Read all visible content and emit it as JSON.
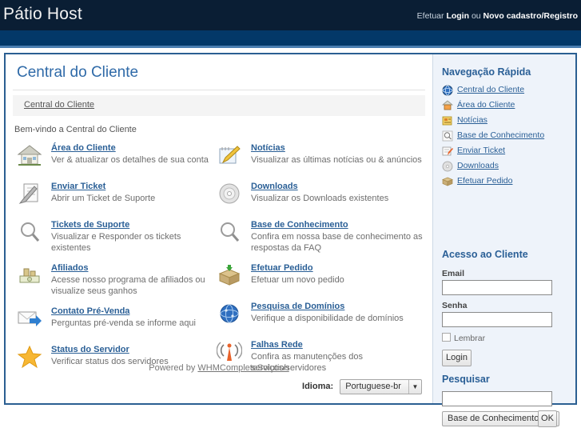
{
  "header": {
    "brand": "Pátio Host",
    "auth_prefix": "Efetuar",
    "login_label": "Login",
    "auth_sep": "ou",
    "register_label": "Novo cadastro/Registro"
  },
  "main": {
    "page_title": "Central do Cliente",
    "breadcrumb": "Central do Cliente",
    "welcome": "Bem-vindo a Central do Cliente",
    "powered_prefix": "Powered by",
    "powered_link": "WHMCompleteSolution",
    "language_label": "Idioma:",
    "language_value": "Portuguese-br",
    "left_items": [
      {
        "icon": "house-icon",
        "title": "Área do Cliente",
        "desc": "Ver & atualizar os detalhes de sua conta"
      },
      {
        "icon": "pencil-paper-icon",
        "title": "Enviar Ticket",
        "desc": "Abrir um Ticket de Suporte"
      },
      {
        "icon": "magnifier-icon",
        "title": "Tickets de Suporte",
        "desc": "Visualizar e Responder os tickets existentes"
      },
      {
        "icon": "money-icon",
        "title": "Afiliados",
        "desc": "Acesse nosso programa de afiliados ou visualize seus ganhos"
      },
      {
        "icon": "envelope-arrow-icon",
        "title": "Contato Pré-Venda",
        "desc": "Perguntas pré-venda se informe aqui"
      },
      {
        "icon": "star-icon",
        "title": "Status do Servidor",
        "desc": "Verificar status dos servidores"
      }
    ],
    "right_items": [
      {
        "icon": "notepad-pencil-icon",
        "title": "Notícias",
        "desc": "Visualizar as últimas notícias ou & anúncios"
      },
      {
        "icon": "disc-icon",
        "title": "Downloads",
        "desc": "Visualizar os Downloads existentes"
      },
      {
        "icon": "magnifier-icon",
        "title": "Base de Conhecimento",
        "desc": "Confira em nossa base de conhecimento as respostas da FAQ"
      },
      {
        "icon": "box-icon",
        "title": "Efetuar Pedido",
        "desc": "Efetuar um novo pedido"
      },
      {
        "icon": "globe-icon",
        "title": "Pesquisa de Domínios",
        "desc": "Verifique a disponibilidade de domínios"
      },
      {
        "icon": "antenna-icon",
        "title": "Falhas Rede",
        "desc": "Confira as manutenções dos serviços/servidores"
      }
    ]
  },
  "sidebar": {
    "nav_title": "Navegação Rápida",
    "nav_items": [
      {
        "icon": "globe-icon",
        "label": "Central do Cliente"
      },
      {
        "icon": "house-icon",
        "label": "Área do Cliente"
      },
      {
        "icon": "news-icon",
        "label": "Notícias"
      },
      {
        "icon": "magnifier-icon",
        "label": "Base de Conhecimento"
      },
      {
        "icon": "ticket-icon",
        "label": "Enviar Ticket"
      },
      {
        "icon": "disc-icon",
        "label": "Downloads"
      },
      {
        "icon": "box-icon",
        "label": "Efetuar Pedido"
      }
    ],
    "login_title": "Acesso ao Cliente",
    "email_label": "Email",
    "email_value": "",
    "password_label": "Senha",
    "password_value": "",
    "remember_label": "Lembrar",
    "login_button": "Login",
    "search_title": "Pesquisar",
    "search_value": "",
    "search_scope": "Base de Conhecimento",
    "search_button": "OK"
  },
  "colors": {
    "header_dark": "#0a1e34",
    "header_blue": "#033868",
    "accent": "#2a5f96",
    "sidebar_bg": "#eef3fa"
  }
}
